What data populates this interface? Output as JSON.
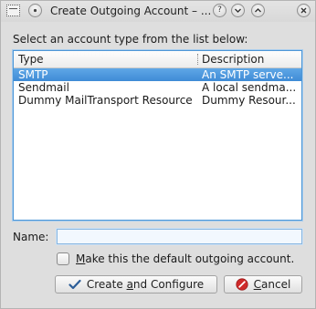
{
  "window": {
    "title": "Create Outgoing Account – ...",
    "help_glyph": "?",
    "minimize_glyph": "⌄",
    "maximize_glyph": "⌃"
  },
  "prompt": "Select an account type from the list below:",
  "table": {
    "columns": [
      "Type",
      "Description"
    ],
    "rows": [
      {
        "type": "SMTP",
        "description": "An SMTP serve...",
        "selected": true
      },
      {
        "type": "Sendmail",
        "description": "A local sendma...",
        "selected": false
      },
      {
        "type": "Dummy MailTransport Resource",
        "description": "Dummy Resour...",
        "selected": false
      }
    ]
  },
  "name_field": {
    "label": "Name:",
    "value": ""
  },
  "default_checkbox": {
    "label_prefix": "M",
    "label_rest": "ake this the default outgoing account.",
    "checked": false
  },
  "buttons": {
    "create": {
      "pre": "Create ",
      "accel": "a",
      "post": "nd Configure",
      "icon": "checkmark-icon"
    },
    "cancel": {
      "pre": "",
      "accel": "C",
      "post": "ancel",
      "icon": "cancel-icon"
    }
  },
  "colors": {
    "selection": "#3f8bd6",
    "check_icon": "#2c5d98",
    "cancel_icon": "#cf2a2a"
  }
}
